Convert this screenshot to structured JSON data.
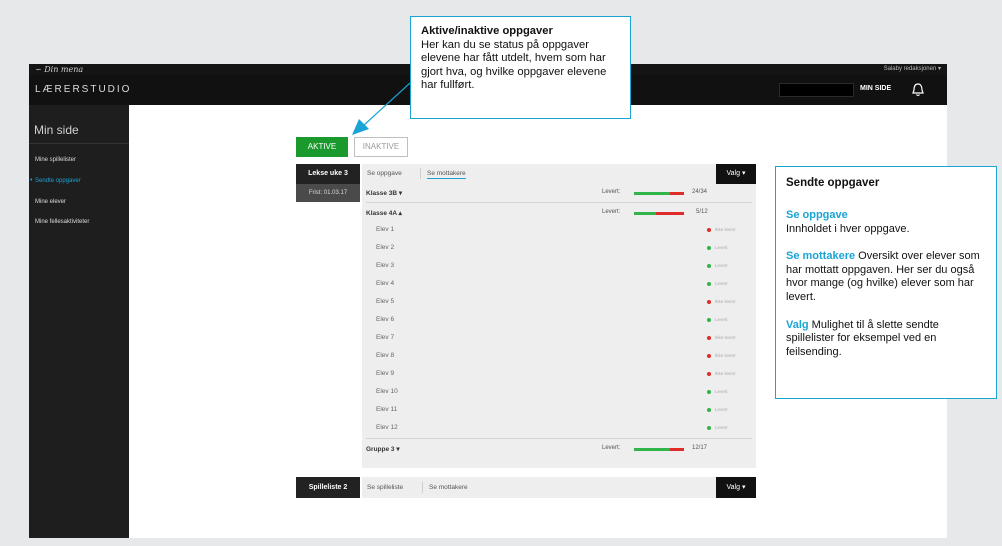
{
  "topbar": {
    "logo": "∽ Din mena",
    "org": "Salaby redaksjonen ▾"
  },
  "header": {
    "brand": "LÆRERSTUDIO",
    "min_side": "MIN SIDE"
  },
  "sidebar": {
    "title": "Min side",
    "items": [
      {
        "label": "Mine spillelister"
      },
      {
        "label": "Sendte oppgaver"
      },
      {
        "label": "Mine elever"
      },
      {
        "label": "Mine fellesaktiviteter"
      }
    ]
  },
  "filters": {
    "aktive": "AKTIVE",
    "inaktive": "INAKTIVE"
  },
  "task1": {
    "label": "Lekse uke 3",
    "frist": "Frist: 01.03.17",
    "tab_oppgave": "Se oppgave",
    "tab_mottakere": "Se mottakere",
    "valg": "Valg ▾",
    "levert_label": "Levert:",
    "groups": [
      {
        "name": "Klasse 3B ▾",
        "count": "24/34",
        "progress": 0.7
      },
      {
        "name": "Klasse 4A ▴",
        "count": "5/12",
        "progress": 0.42
      },
      {
        "name": "Gruppe 3 ▾",
        "count": "12/17",
        "progress": 0.7
      }
    ],
    "students": [
      {
        "name": "Elev 1",
        "status": "Ikke levert",
        "color": "#e02b2b"
      },
      {
        "name": "Elev 2",
        "status": "Levert",
        "color": "#2fb54a"
      },
      {
        "name": "Elev 3",
        "status": "Levert",
        "color": "#2fb54a"
      },
      {
        "name": "Elev 4",
        "status": "Levert",
        "color": "#2fb54a"
      },
      {
        "name": "Elev 5",
        "status": "Ikke levert",
        "color": "#e02b2b"
      },
      {
        "name": "Elev 6",
        "status": "Levert",
        "color": "#2fb54a"
      },
      {
        "name": "Elev 7",
        "status": "Ikke levert",
        "color": "#e02b2b"
      },
      {
        "name": "Elev 8",
        "status": "Ikke levert",
        "color": "#e02b2b"
      },
      {
        "name": "Elev 9",
        "status": "Ikke levert",
        "color": "#e02b2b"
      },
      {
        "name": "Elev 10",
        "status": "Levert",
        "color": "#2fb54a"
      },
      {
        "name": "Elev 11",
        "status": "Levert",
        "color": "#2fb54a"
      },
      {
        "name": "Elev 12",
        "status": "Levert",
        "color": "#2fb54a"
      }
    ]
  },
  "task2": {
    "label": "Spilleliste 2",
    "tab_spilleliste": "Se spilleliste",
    "tab_mottakere": "Se mottakere",
    "valg": "Valg ▾"
  },
  "callout_top": {
    "title": "Aktive/inaktive oppgaver",
    "text": "Her kan du se status på oppgaver elevene har fått utdelt, hvem som har gjort hva, og hvilke oppgaver elevene har fullført."
  },
  "callout_right": {
    "title": "Sendte oppgaver",
    "p1_key": "Se oppgave",
    "p1_text": "Innholdet i hver oppgave.",
    "p2_key": "Se mottakere",
    "p2_text": " Oversikt over elever som har mottatt oppgaven. Her ser du også hvor mange (og hvilke) elever som har levert.",
    "p3_key": "Valg",
    "p3_text": " Mulighet til å slette sendte spillelister for eksempel ved en feilsending."
  },
  "colors": {
    "accent": "#19a4d6",
    "green": "#1a9a2c",
    "red": "#e02b2b"
  }
}
